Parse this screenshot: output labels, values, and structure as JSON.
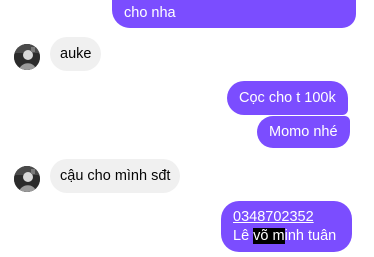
{
  "messages": {
    "out_1": "cho nha",
    "in_1": "auke",
    "out_2": "Cọc cho t 100k",
    "out_3": "Momo nhé",
    "in_2": "cậu cho mình sđt",
    "out_4": {
      "phone": "0348702352",
      "name_before": "Lê ",
      "name_highlight": "võ m",
      "name_after": "inh tuân"
    }
  },
  "avatars": {
    "icon": "avatar-photo"
  },
  "colors": {
    "outgoing_bubble": "#7b4dff",
    "incoming_bubble": "#f0f0f0",
    "background": "#ffffff",
    "selection_highlight": "#000000"
  }
}
